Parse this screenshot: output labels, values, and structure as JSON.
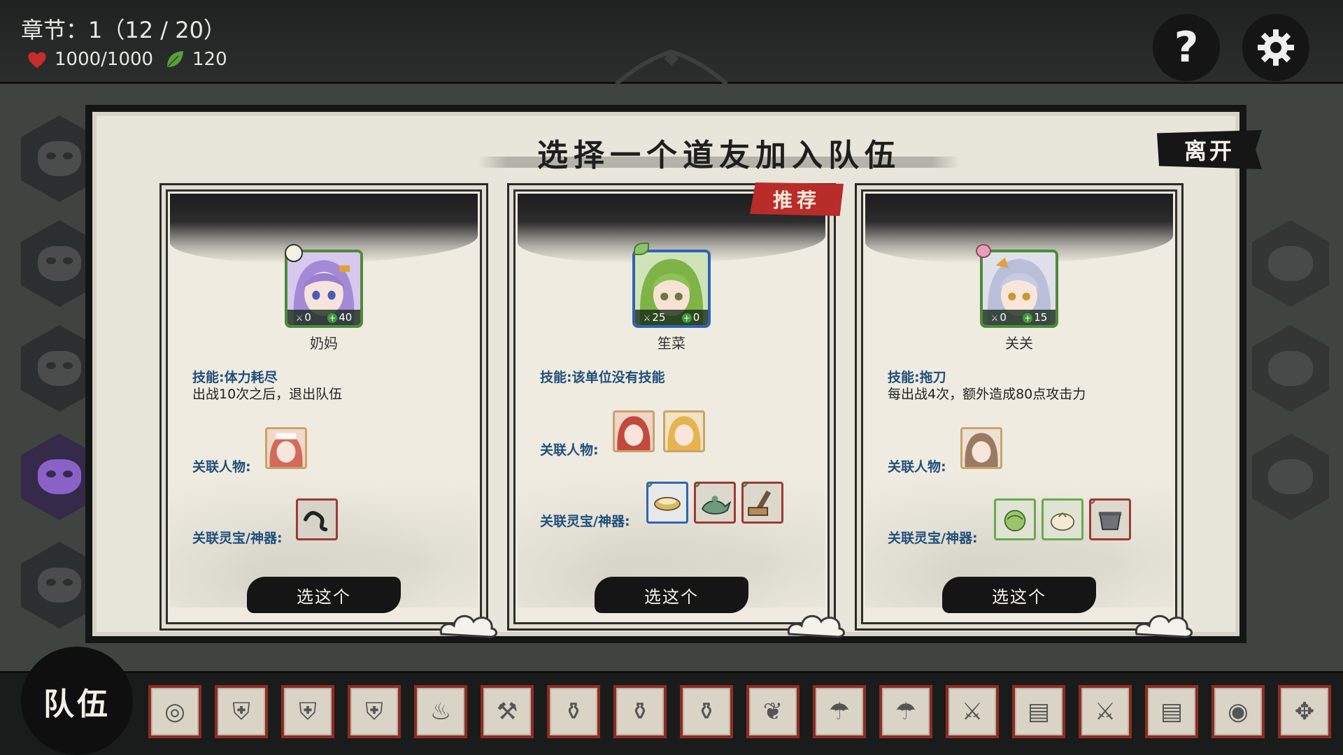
{
  "hud": {
    "chapter": "章节：1（12 / 20）",
    "hp": "1000/1000",
    "spirit": "120",
    "help_label": "?",
    "colors": {
      "hp": "#c82c2c",
      "spirit": "#5aa03a"
    }
  },
  "dialog": {
    "title": "选择一个道友加入队伍",
    "leave_label": "离开"
  },
  "cards": [
    {
      "name": "奶妈",
      "attack": "0",
      "heal": "40",
      "frame_color": "green",
      "recommended": false,
      "skill_title": "技能:体力耗尽",
      "skill_desc": "出战10次之后，退出队伍",
      "related_people_label": "关联人物:",
      "related_artifacts_label": "关联灵宝/神器:",
      "choose_label": "选这个"
    },
    {
      "name": "笙菜",
      "attack": "25",
      "heal": "0",
      "frame_color": "blue",
      "recommended": true,
      "recommend_label": "推荐",
      "skill_title": "技能:该单位没有技能",
      "skill_desc": "",
      "related_people_label": "关联人物:",
      "related_artifacts_label": "关联灵宝/神器:",
      "choose_label": "选这个"
    },
    {
      "name": "关关",
      "attack": "0",
      "heal": "15",
      "frame_color": "green",
      "recommended": false,
      "skill_title": "技能:拖刀",
      "skill_desc": "每出战4次，额外造成80点攻击力",
      "related_people_label": "关联人物:",
      "related_artifacts_label": "关联灵宝/神器:",
      "choose_label": "选这个"
    }
  ],
  "bottom": {
    "team_label": "队伍",
    "inventory_icons": [
      "ring-icon",
      "armor-icon",
      "armor-icon",
      "armor-icon",
      "lamp-icon",
      "hammer-icon",
      "pot-icon",
      "pot-icon",
      "cauldron-icon",
      "fish-icon",
      "umbrella-icon",
      "umbrella-icon",
      "dagger-icon",
      "scroll-icon",
      "blade-icon",
      "scroll-icon",
      "bowl-icon",
      "staff-icon"
    ],
    "inventory_glyphs": [
      "◎",
      "⛨",
      "⛨",
      "⛨",
      "♨",
      "⚒",
      "⚱",
      "⚱",
      "⚱",
      "❦",
      "☂",
      "☂",
      "⚔",
      "▤",
      "⚔",
      "▤",
      "◉",
      "✥"
    ]
  }
}
